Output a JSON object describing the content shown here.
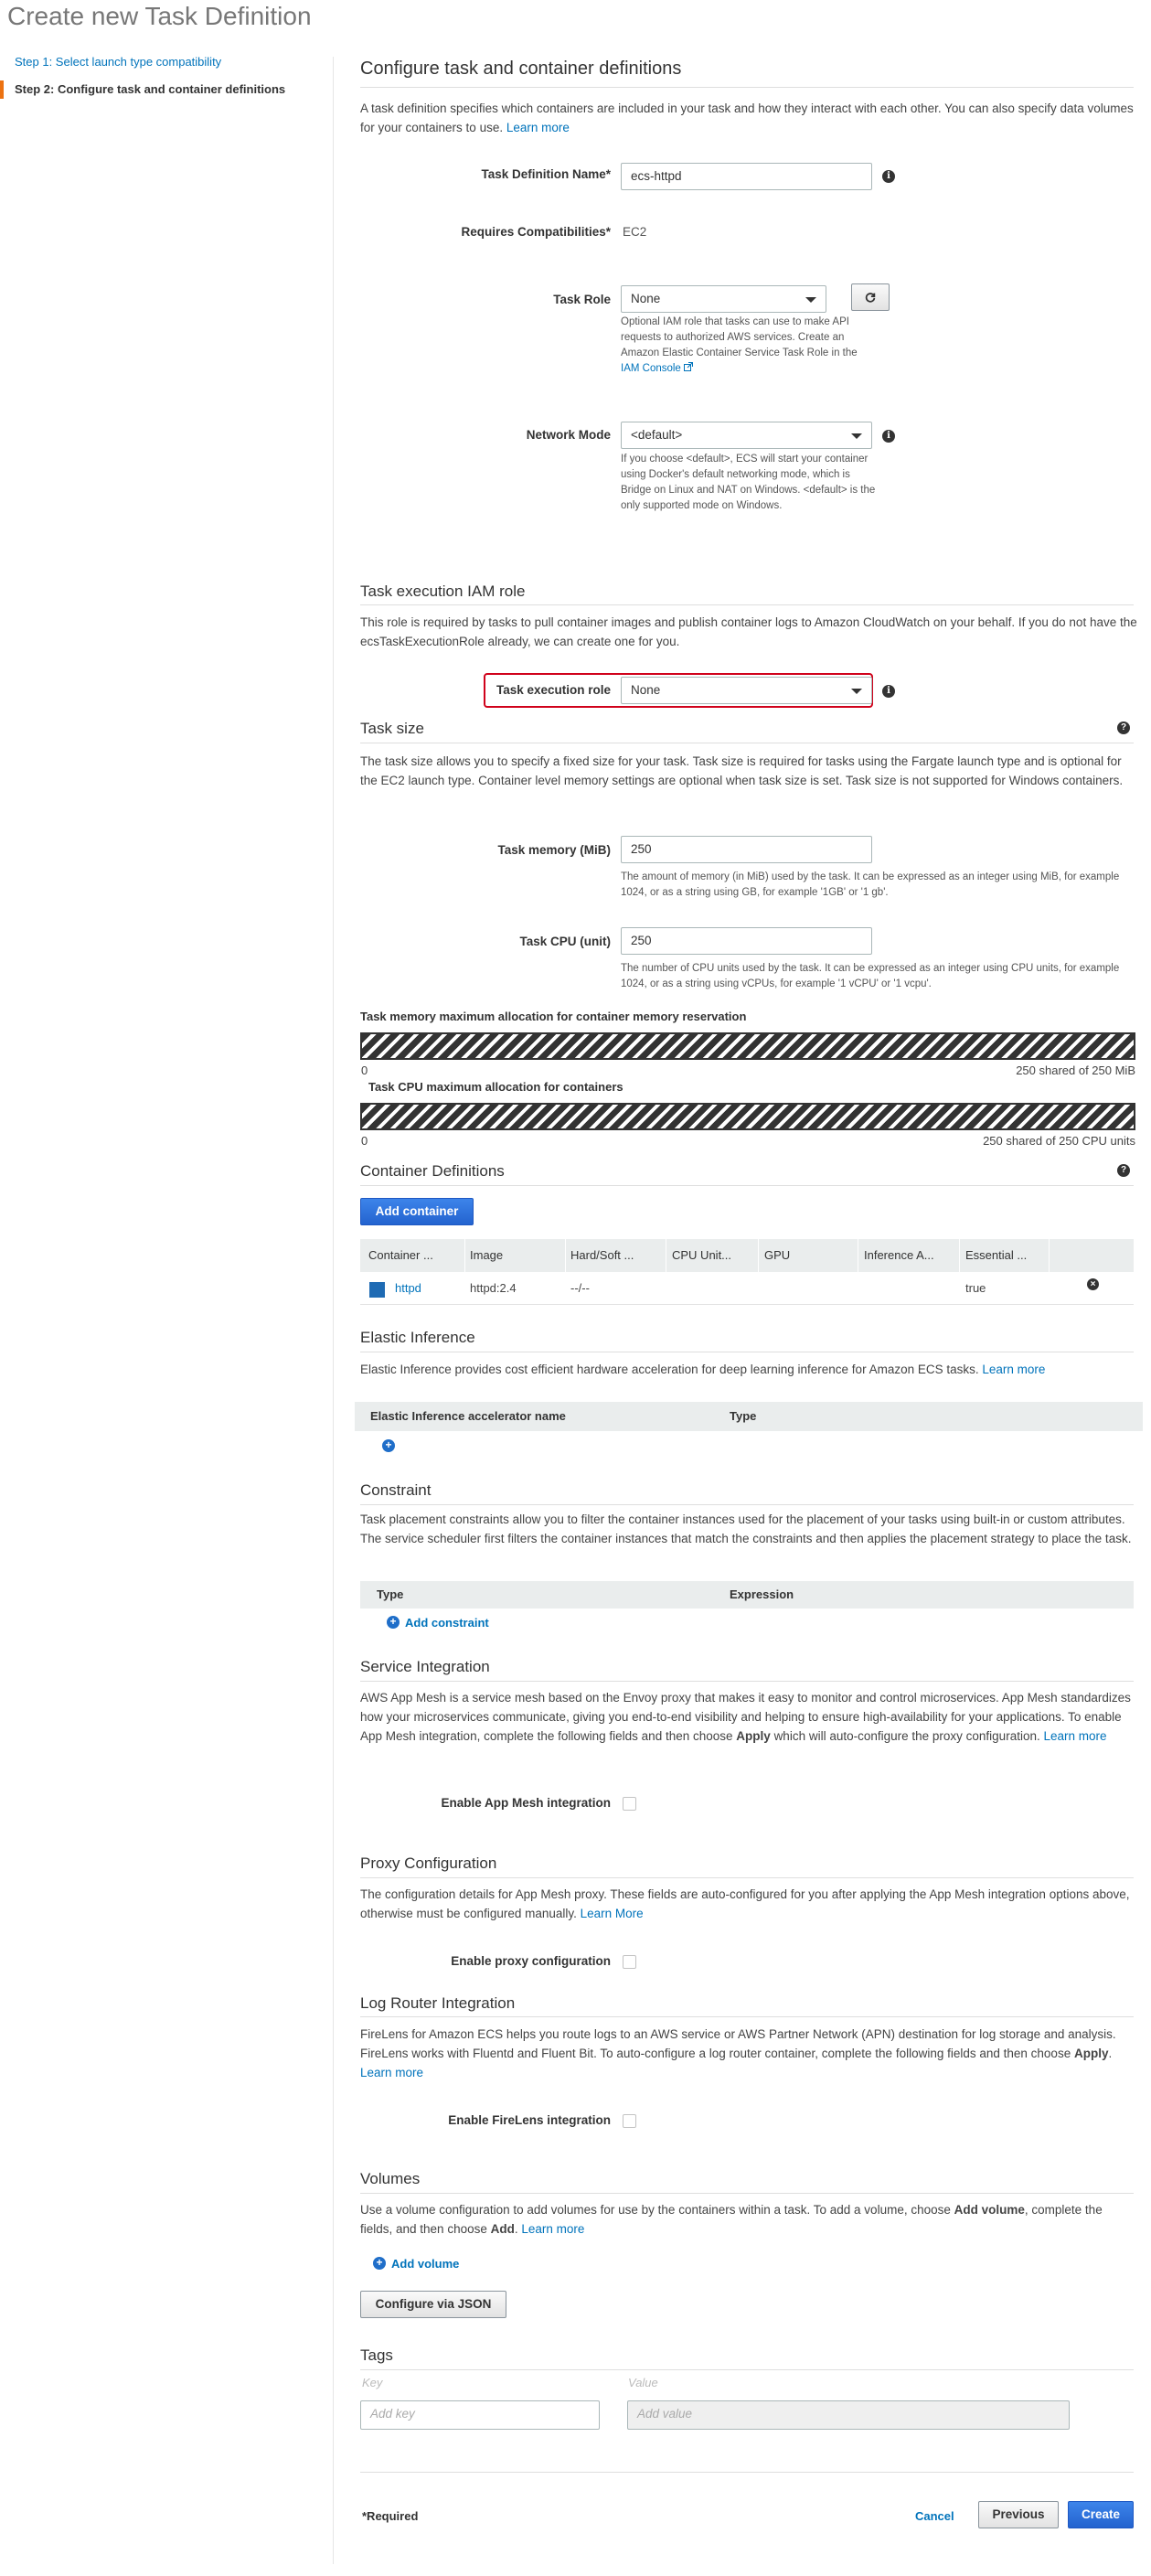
{
  "page_title": "Create new Task Definition",
  "sidebar": {
    "step1": "Step 1: Select launch type compatibility",
    "step2": "Step 2: Configure task and container definitions"
  },
  "main": {
    "heading": "Configure task and container definitions",
    "intro": "A task definition specifies which containers are included in your task and how they interact with each other. You can also specify data volumes for your containers to use.",
    "learn_more": "Learn more",
    "task_def_name_label": "Task Definition Name*",
    "task_def_name_value": "ecs-httpd",
    "requires_compat_label": "Requires Compatibilities*",
    "requires_compat_value": "EC2",
    "task_role_label": "Task Role",
    "task_role_value": "None",
    "task_role_help": "Optional IAM role that tasks can use to make API requests to authorized AWS services. Create an Amazon Elastic Container Service Task Role in the",
    "iam_console_link": "IAM Console",
    "network_mode_label": "Network Mode",
    "network_mode_value": "<default>",
    "network_mode_help": "If you choose <default>, ECS will start your container using Docker's default networking mode, which is Bridge on Linux and NAT on Windows. <default> is the only supported mode on Windows."
  },
  "exec_role": {
    "heading": "Task execution IAM role",
    "desc": "This role is required by tasks to pull container images and publish container logs to Amazon CloudWatch on your behalf. If you do not have the ecsTaskExecutionRole already, we can create one for you.",
    "label": "Task execution role",
    "value": "None"
  },
  "task_size": {
    "heading": "Task size",
    "desc": "The task size allows you to specify a fixed size for your task. Task size is required for tasks using the Fargate launch type and is optional for the EC2 launch type. Container level memory settings are optional when task size is set. Task size is not supported for Windows containers.",
    "memory_label": "Task memory (MiB)",
    "memory_value": "250",
    "memory_help": "The amount of memory (in MiB) used by the task. It can be expressed as an integer using MiB, for example 1024, or as a string using GB, for example '1GB' or '1 gb'.",
    "cpu_label": "Task CPU (unit)",
    "cpu_value": "250",
    "cpu_help": "The number of CPU units used by the task. It can be expressed as an integer using CPU units, for example 1024, or as a string using vCPUs, for example '1 vCPU' or '1 vcpu'.",
    "mem_alloc_title": "Task memory maximum allocation for container memory reservation",
    "mem_alloc_min": "0",
    "mem_alloc_max": "250 shared of 250 MiB",
    "mem_alloc_fraction": 1.0,
    "cpu_alloc_title": "Task CPU maximum allocation for containers",
    "cpu_alloc_min": "0",
    "cpu_alloc_max": "250 shared of 250 CPU units",
    "cpu_alloc_fraction": 1.0
  },
  "containers": {
    "heading": "Container Definitions",
    "add_button": "Add container",
    "columns": [
      "Container ...",
      "Image",
      "Hard/Soft ...",
      "CPU Unit...",
      "GPU",
      "Inference A...",
      "Essential ..."
    ],
    "row": {
      "name": "httpd",
      "image": "httpd:2.4",
      "limits": "--/--",
      "cpu": "",
      "gpu": "",
      "inference": "",
      "essential": "true"
    }
  },
  "elastic_inference": {
    "heading": "Elastic Inference",
    "desc": "Elastic Inference provides cost efficient hardware acceleration for deep learning inference for Amazon ECS tasks.",
    "learn_more": "Learn more",
    "col1": "Elastic Inference accelerator name",
    "col2": "Type"
  },
  "constraint": {
    "heading": "Constraint",
    "desc": "Task placement constraints allow you to filter the container instances used for the placement of your tasks using built-in or custom attributes. The service scheduler first filters the container instances that match the constraints and then applies the placement strategy to place the task.",
    "col1": "Type",
    "col2": "Expression",
    "add": "Add constraint"
  },
  "service_integration": {
    "heading": "Service Integration",
    "desc_a": "AWS App Mesh is a service mesh based on the Envoy proxy that makes it easy to monitor and control microservices. App Mesh standardizes how your microservices communicate, giving you end-to-end visibility and helping to ensure high-availability for your applications. To enable App Mesh integration, complete the following fields and then choose",
    "desc_bold": "Apply",
    "desc_b": "which will auto-configure the proxy configuration.",
    "learn_more": "Learn more",
    "label": "Enable App Mesh integration"
  },
  "proxy": {
    "heading": "Proxy Configuration",
    "desc": "The configuration details for App Mesh proxy. These fields are auto-configured for you after applying the App Mesh integration options above, otherwise must be configured manually.",
    "learn_more": "Learn More",
    "label": "Enable proxy configuration"
  },
  "log_router": {
    "heading": "Log Router Integration",
    "desc_a": "FireLens for Amazon ECS helps you route logs to an AWS service or AWS Partner Network (APN) destination for log storage and analysis. FireLens works with Fluentd and Fluent Bit. To auto-configure a log router container, complete the following fields and then choose",
    "desc_bold": "Apply",
    "learn_more": "Learn more",
    "label": "Enable FireLens integration"
  },
  "volumes": {
    "heading": "Volumes",
    "desc_a": "Use a volume configuration to add volumes for use by the containers within a task. To add a volume, choose",
    "desc_bold1": "Add volume",
    "desc_b": ", complete the fields, and then choose",
    "desc_bold2": "Add",
    "learn_more": "Learn more",
    "add": "Add volume",
    "json_button": "Configure via JSON"
  },
  "tags": {
    "heading": "Tags",
    "key_label": "Key",
    "value_label": "Value",
    "key_placeholder": "Add key",
    "value_placeholder": "Add value"
  },
  "footer": {
    "required": "*Required",
    "cancel": "Cancel",
    "previous": "Previous",
    "create": "Create"
  },
  "colors": {
    "accent_orange": "#ec7211",
    "link_blue": "#0073bb",
    "primary_blue": "#2363cf",
    "highlight_red": "#d0021b"
  },
  "icons": [
    "info-icon",
    "refresh-icon",
    "external-link-icon",
    "help-icon",
    "container-icon",
    "remove-icon",
    "add-icon"
  ]
}
